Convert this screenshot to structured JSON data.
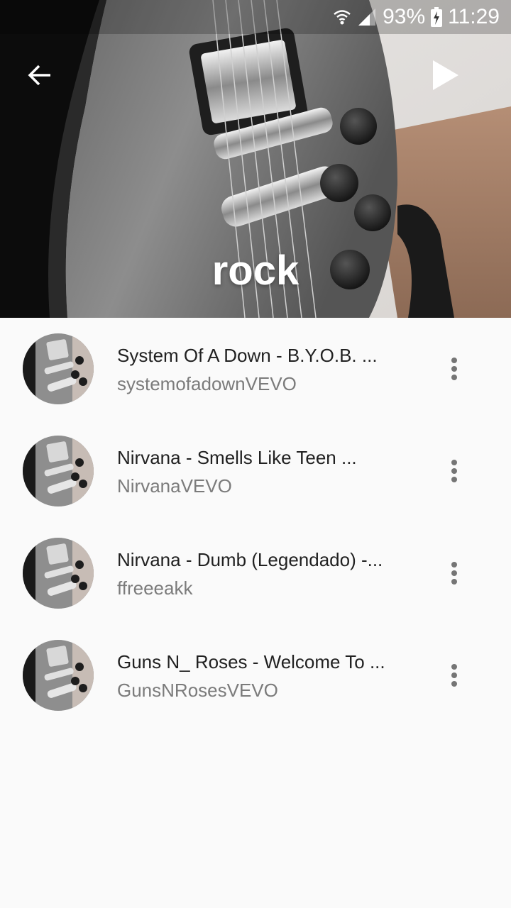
{
  "status_bar": {
    "battery": "93%",
    "time": "11:29",
    "icons": [
      "wifi-icon",
      "signal-icon",
      "battery-charging-icon"
    ]
  },
  "header": {
    "title": "rock",
    "back_icon": "arrow-back-icon",
    "play_icon": "play-icon"
  },
  "songs": [
    {
      "title": "System Of A Down - B.Y.O.B. ...",
      "channel": "systemofadownVEVO"
    },
    {
      "title": "Nirvana - Smells Like Teen ...",
      "channel": "NirvanaVEVO"
    },
    {
      "title": "Nirvana - Dumb (Legendado) -...",
      "channel": "ffreeeakk"
    },
    {
      "title": "Guns N_ Roses - Welcome To ...",
      "channel": "GunsNRosesVEVO"
    }
  ],
  "colors": {
    "background": "#fafafa",
    "title_text": "#212121",
    "secondary_text": "#7b7b7b",
    "header_text": "#ffffff"
  }
}
